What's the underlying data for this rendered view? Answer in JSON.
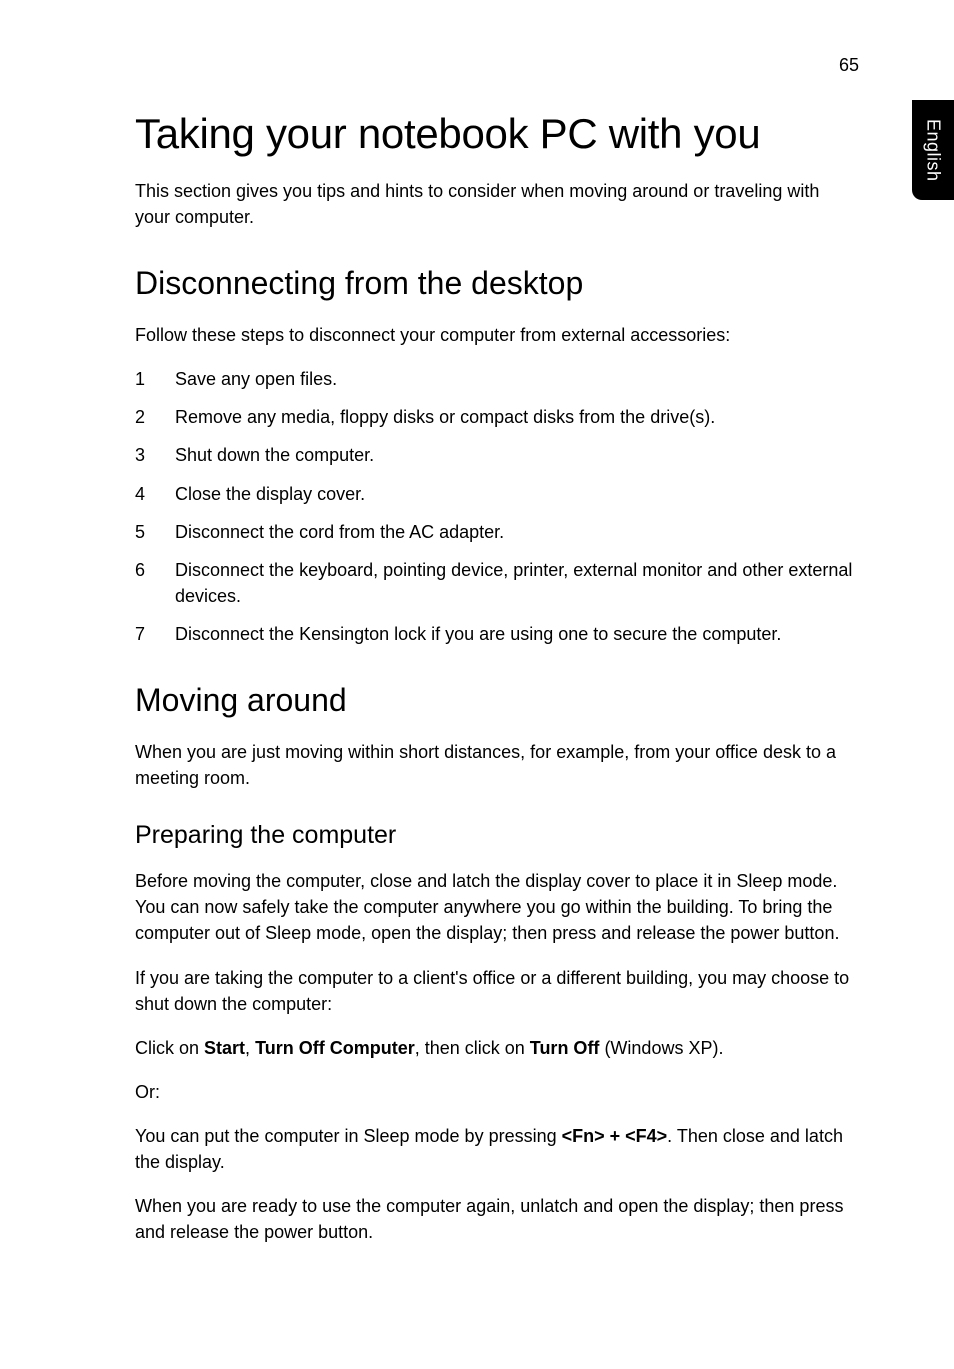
{
  "page_number": "65",
  "side_tab": "English",
  "title": "Taking your notebook PC with you",
  "intro": "This section gives you tips and hints to consider when moving around or traveling with your computer.",
  "section1": {
    "heading": "Disconnecting from the desktop",
    "lead": "Follow these steps to disconnect your computer from external accessories:",
    "steps": [
      {
        "num": "1",
        "text": "Save any open files."
      },
      {
        "num": "2",
        "text": "Remove any media, floppy disks or compact disks from the drive(s)."
      },
      {
        "num": "3",
        "text": "Shut down the computer."
      },
      {
        "num": "4",
        "text": "Close the display cover."
      },
      {
        "num": "5",
        "text": "Disconnect the cord from the AC adapter."
      },
      {
        "num": "6",
        "text": "Disconnect the keyboard, pointing device, printer, external monitor and other external devices."
      },
      {
        "num": "7",
        "text": "Disconnect the Kensington lock if you are using one to secure the computer."
      }
    ]
  },
  "section2": {
    "heading": "Moving around",
    "lead": "When you are just moving within short distances, for example, from your office desk to a meeting room.",
    "sub_heading": "Preparing the computer",
    "p1": "Before moving the computer, close and latch the display cover to place it in Sleep mode. You can now safely take the computer anywhere you go within the building. To bring the computer out of Sleep mode, open the display; then press and release the power button.",
    "p2": "If you are taking the computer to a client's office or a different building, you may choose to shut down the computer:",
    "p3_pre": "Click on ",
    "p3_b1": "Start",
    "p3_mid1": ", ",
    "p3_b2": "Turn Off Computer",
    "p3_mid2": ", then click on ",
    "p3_b3": "Turn Off",
    "p3_post": " (Windows XP).",
    "p4": "Or:",
    "p5_pre": "You can put the computer in Sleep mode by pressing ",
    "p5_b1": "<Fn> + <F4>",
    "p5_post": ". Then close and latch the display.",
    "p6": "When you are ready to use the computer again, unlatch and open the display; then press and release the power button."
  }
}
